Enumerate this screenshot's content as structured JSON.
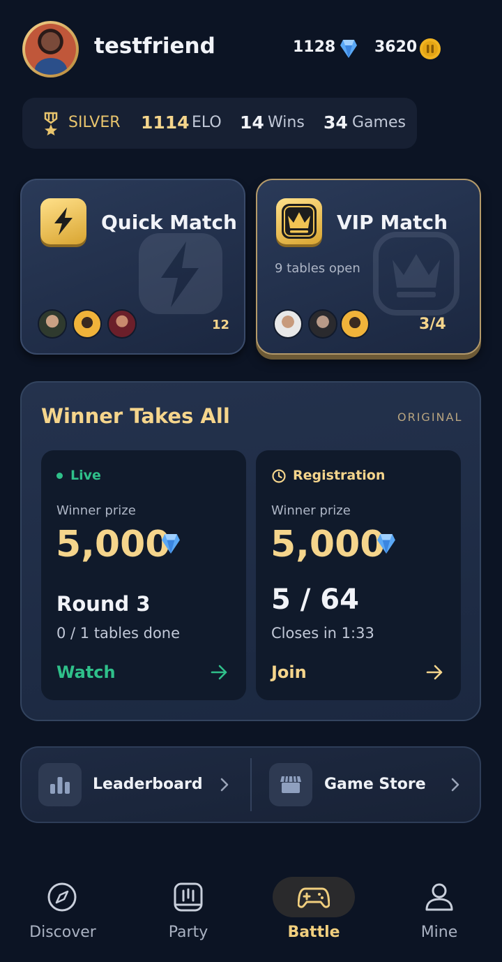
{
  "header": {
    "username": "testfriend",
    "gems": "1128",
    "coins": "3620"
  },
  "stats": {
    "rank": "SILVER",
    "elo_value": "1114",
    "elo_label": "ELO",
    "wins_value": "14",
    "wins_label": "Wins",
    "games_value": "34",
    "games_label": "Games"
  },
  "quick_match": {
    "title": "Quick Match",
    "count": "12"
  },
  "vip_match": {
    "title": "VIP Match",
    "subtitle": "9 tables open",
    "count": "3/4"
  },
  "tournament": {
    "title": "Winner Takes All",
    "tag": "ORIGINAL",
    "live": {
      "status": "Live",
      "prize_label": "Winner prize",
      "prize": "5,000",
      "headline": "Round 3",
      "detail": "0 / 1 tables done",
      "action": "Watch"
    },
    "registration": {
      "status": "Registration",
      "prize_label": "Winner prize",
      "prize": "5,000",
      "headline": "5 / 64",
      "detail": "Closes in 1:33",
      "action": "Join"
    }
  },
  "links": {
    "leaderboard": "Leaderboard",
    "store": "Game Store"
  },
  "nav": {
    "discover": "Discover",
    "party": "Party",
    "battle": "Battle",
    "mine": "Mine",
    "active": "Battle"
  },
  "colors": {
    "accent_gold": "#f5d58c",
    "live_green": "#2fc08a",
    "background": "#0c1424"
  }
}
